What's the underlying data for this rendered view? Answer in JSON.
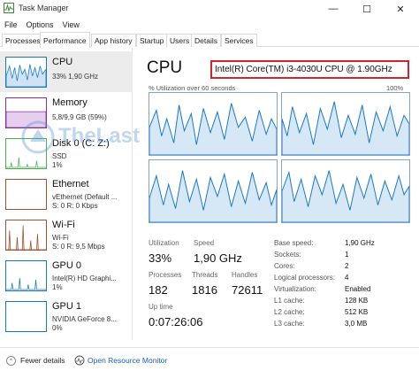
{
  "window": {
    "title": "Task Manager"
  },
  "menu": [
    "File",
    "Options",
    "View"
  ],
  "tabs": [
    "Processes",
    "Performance",
    "App history",
    "Startup",
    "Users",
    "Details",
    "Services"
  ],
  "active_tab": "Performance",
  "colors": {
    "cpu": "#1779c4",
    "memory": "#8b2fa3",
    "disk": "#4caf50",
    "ethernet": "#a0522d",
    "wifi": "#a0522d",
    "gpu": "#1779c4",
    "highlight_box": "#d0252e",
    "link": "#1a5fb4"
  },
  "sidebar": [
    {
      "title": "CPU",
      "lines": [
        "33% 1,90 GHz"
      ]
    },
    {
      "title": "Memory",
      "lines": [
        "5,8/9,9 GB (59%)"
      ]
    },
    {
      "title": "Disk 0 (C: Z:)",
      "lines": [
        "SSD",
        "1%"
      ]
    },
    {
      "title": "Ethernet",
      "lines": [
        "vEthernet (Default ...",
        "S: 0 R: 0 Kbps"
      ]
    },
    {
      "title": "Wi-Fi",
      "lines": [
        "Wi-Fi",
        "S: 0 R: 9,5 Mbps"
      ]
    },
    {
      "title": "GPU 0",
      "lines": [
        "Intel(R) HD Graphi...",
        "1%"
      ]
    },
    {
      "title": "GPU 1",
      "lines": [
        "NVIDIA GeForce 8...",
        "0%"
      ]
    }
  ],
  "main": {
    "heading": "CPU",
    "model": "Intel(R) Core(TM) i3-4030U CPU @ 1.90GHz",
    "util_label": "% Utilization over 60 seconds",
    "util_max": "100%",
    "stats": {
      "utilization_label": "Utilization",
      "utilization": "33%",
      "speed_label": "Speed",
      "speed": "1,90 GHz",
      "processes_label": "Processes",
      "processes": "182",
      "threads_label": "Threads",
      "threads": "1816",
      "handles_label": "Handles",
      "handles": "72611",
      "uptime_label": "Up time",
      "uptime": "0:07:26:06"
    },
    "details": [
      {
        "k": "Base speed:",
        "v": "1,90 GHz"
      },
      {
        "k": "Sockets:",
        "v": "1"
      },
      {
        "k": "Cores:",
        "v": "2"
      },
      {
        "k": "Logical processors:",
        "v": "4"
      },
      {
        "k": "Virtualization:",
        "v": "Enabled"
      },
      {
        "k": "L1 cache:",
        "v": "128 KB"
      },
      {
        "k": "L2 cache:",
        "v": "512 KB"
      },
      {
        "k": "L3 cache:",
        "v": "3,0 MB"
      }
    ]
  },
  "watermark": "TheLast",
  "footer": {
    "fewer_details": "Fewer details",
    "resource_monitor": "Open Resource Monitor"
  }
}
